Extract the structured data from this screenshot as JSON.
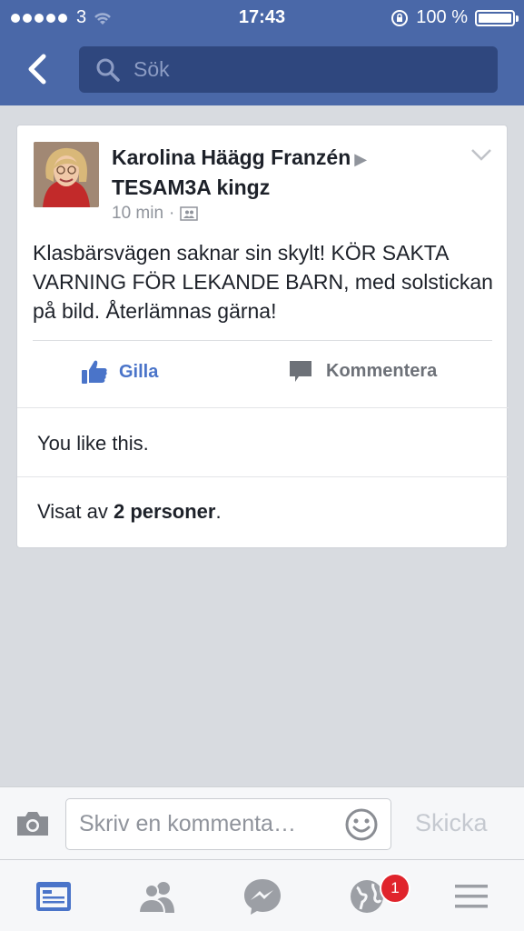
{
  "status_bar": {
    "carrier": "3",
    "time": "17:43",
    "battery": "100 %"
  },
  "nav": {
    "search_placeholder": "Sök"
  },
  "post": {
    "author": "Karolina Häägg Franzén",
    "separator": "▶",
    "group": "TESAM3A kingz",
    "time": "10 min",
    "dot": "·",
    "text": "Klasbärsvägen saknar sin skylt! KÖR SAKTA VARNING FÖR LEKANDE BARN, med solstickan på bild. Återlämnas gärna!",
    "like_label": "Gilla",
    "comment_label": "Kommentera",
    "likes_text": "You like this.",
    "seen_prefix": "Visat av ",
    "seen_count": "2 personer",
    "seen_suffix": "."
  },
  "composer": {
    "placeholder": "Skriv en kommenta…",
    "send_label": "Skicka"
  },
  "tabbar": {
    "notifications_badge": "1"
  },
  "colors": {
    "brand": "#4a68a8",
    "like_blue": "#4a74c9",
    "badge_red": "#e0242c"
  }
}
